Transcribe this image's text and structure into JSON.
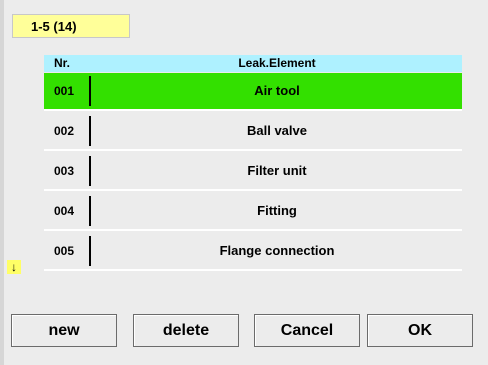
{
  "range_label": "1-5 (14)",
  "table": {
    "col_nr": "Nr.",
    "col_name": "Leak.Element",
    "rows": [
      {
        "nr": "001",
        "name": "Air tool"
      },
      {
        "nr": "002",
        "name": "Ball valve"
      },
      {
        "nr": "003",
        "name": "Filter unit"
      },
      {
        "nr": "004",
        "name": "Fitting"
      },
      {
        "nr": "005",
        "name": "Flange connection"
      }
    ],
    "selected_index": 0
  },
  "scroll_icon": "arrow-down-icon",
  "buttons": {
    "new": "new",
    "delete": "delete",
    "cancel": "Cancel",
    "ok": "OK"
  },
  "colors": {
    "header_bg": "#aef1ff",
    "selected_bg": "#33e000",
    "badge_bg": "#ffff99"
  }
}
